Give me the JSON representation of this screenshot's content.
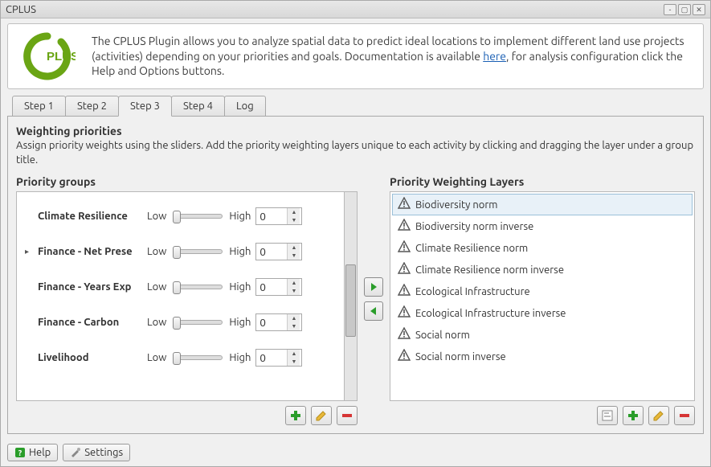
{
  "window": {
    "title": "CPLUS"
  },
  "intro": {
    "text_before": "The CPLUS Plugin allows you to analyze spatial data to predict ideal locations to implement different land use projects (activities) depending on your priorities and goals. Documentation is available ",
    "link_text": "here",
    "text_after": ", for analysis configuration click the Help and Options buttons."
  },
  "tabs": {
    "items": [
      {
        "label": "Step 1",
        "active": false
      },
      {
        "label": "Step 2",
        "active": false
      },
      {
        "label": "Step 3",
        "active": true
      },
      {
        "label": "Step 4",
        "active": false
      },
      {
        "label": "Log",
        "active": false
      }
    ]
  },
  "step3": {
    "heading": "Weighting priorities",
    "subheading": "Assign priority weights using the sliders. Add the priority weighting layers unique to each activity by clicking and dragging the layer under a group title.",
    "priority_groups": {
      "title": "Priority groups",
      "low_label": "Low",
      "high_label": "High",
      "rows": [
        {
          "name": "Climate Resilience",
          "value": "0",
          "expandable": false
        },
        {
          "name": "Finance - Net Prese",
          "value": "0",
          "expandable": true
        },
        {
          "name": "Finance - Years Exp",
          "value": "0",
          "expandable": false
        },
        {
          "name": "Finance - Carbon",
          "value": "0",
          "expandable": false
        },
        {
          "name": "Livelihood",
          "value": "0",
          "expandable": false
        }
      ]
    },
    "priority_layers": {
      "title": "Priority Weighting Layers",
      "items": [
        {
          "label": "Biodiversity norm",
          "selected": true
        },
        {
          "label": "Biodiversity norm inverse",
          "selected": false
        },
        {
          "label": "Climate Resilience norm",
          "selected": false
        },
        {
          "label": "Climate Resilience norm inverse",
          "selected": false
        },
        {
          "label": "Ecological Infrastructure",
          "selected": false
        },
        {
          "label": "Ecological Infrastructure inverse",
          "selected": false
        },
        {
          "label": "Social norm",
          "selected": false
        },
        {
          "label": "Social norm inverse",
          "selected": false
        }
      ]
    }
  },
  "footer": {
    "help": "Help",
    "settings": "Settings"
  }
}
